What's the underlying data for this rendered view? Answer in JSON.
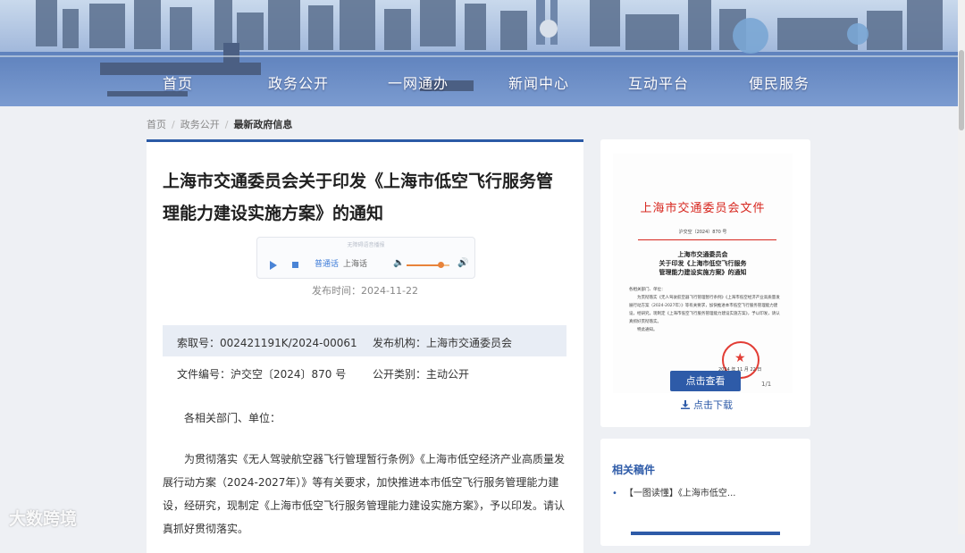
{
  "nav": {
    "items": [
      "首页",
      "政务公开",
      "一网通办",
      "新闻中心",
      "互动平台",
      "便民服务"
    ]
  },
  "breadcrumb": {
    "items": [
      "首页",
      "政务公开",
      "最新政府信息"
    ]
  },
  "article": {
    "title": "上海市交通委员会关于印发《上海市低空飞行服务管理能力建设实施方案》的通知",
    "player": {
      "title": "无障碍语音播报",
      "lang_mandarin": "普通话",
      "lang_shanghai": "上海话",
      "volume_level": 0.8
    },
    "pubdate": "发布时间：2024-11-22",
    "meta": {
      "index_no": "索取号：002421191K/2024-00061",
      "publisher": "发布机构：上海市交通委员会",
      "doc_no": "文件编号：沪交空〔2024〕870 号",
      "category": "公开类别：主动公开"
    },
    "greeting": "各相关部门、单位：",
    "body": "为贯彻落实《无人驾驶航空器飞行管理暂行条例》《上海市低空经济产业高质量发展行动方案（2024-2027年）》等有关要求，加快推进本市低空飞行服务管理能力建设，经研究，现制定《上海市低空飞行服务管理能力建设实施方案》，予以印发。请认真抓好贯彻落实。"
  },
  "doc_preview": {
    "heading": "上海市交通委员会文件",
    "number": "沪交空〔2024〕870 号",
    "title_line1": "上海市交通委员会",
    "title_line2": "关于印发《上海市低空飞行服务",
    "title_line3": "管理能力建设实施方案》的通知",
    "greeting": "各相关部门、单位：",
    "body": "为贯彻落实《无人驾驶航空器飞行管理暂行条例》《上海市低空经济产业高质量发展行动方案（2024-2027年）》等有关要求，加快推进本市低空飞行服务管理能力建设，经研究，现制定《上海市低空飞行服务管理能力建设实施方案》，予以印发，请认真抓好贯彻落实。",
    "closing": "特此通知。",
    "date": "2024 年 11 月 22 日",
    "view_label": "点击查看",
    "download_label": "点击下载",
    "page_hint": "1/1"
  },
  "related": {
    "heading": "相关稿件",
    "items": [
      "【一图读懂】《上海市低空..."
    ]
  },
  "watermark": "大数跨境"
}
